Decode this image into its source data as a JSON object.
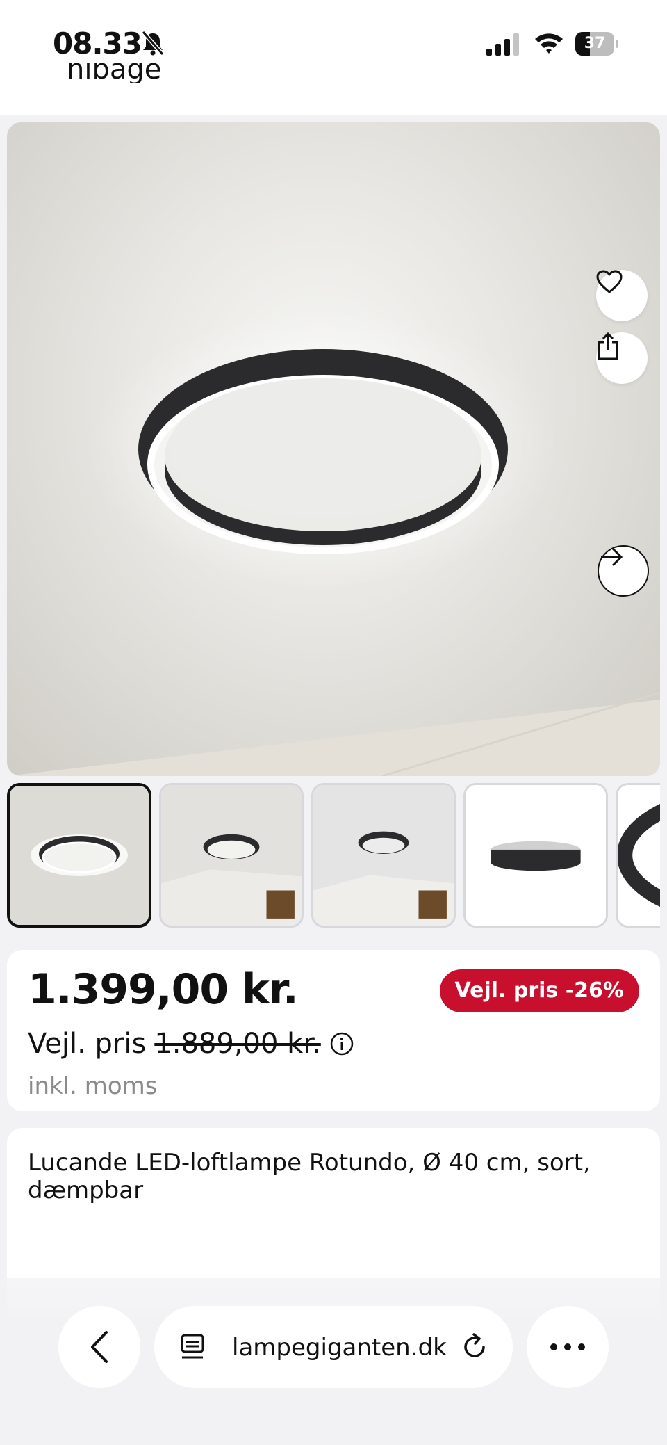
{
  "status_bar": {
    "time": "08.33",
    "battery": "37",
    "battery_level": 0.37
  },
  "page": {
    "cut_heading": "nibage"
  },
  "product": {
    "price": "1.399,00 kr.",
    "rrp_label": "Vejl. pris",
    "rrp_price": "1.889,00 kr.",
    "vat_note": "inkl. moms",
    "discount_badge": "Vejl. pris -26%",
    "title": "Lucande LED-loftlampe Rotundo, Ø 40 cm, sort, dæmpbar"
  },
  "gallery": {
    "thumbnail_count": 5,
    "active_index": 0
  },
  "browser": {
    "url": "lampegiganten.dk"
  },
  "icons": {
    "favorite": "heart-icon",
    "share": "share-icon",
    "next": "arrow-right-icon",
    "info": "info-icon",
    "back": "chevron-left-icon",
    "tabs": "tabs-icon",
    "reload": "reload-icon",
    "more": "more-icon"
  },
  "colors": {
    "badge": "#c8102e",
    "background": "#f2f2f4"
  }
}
